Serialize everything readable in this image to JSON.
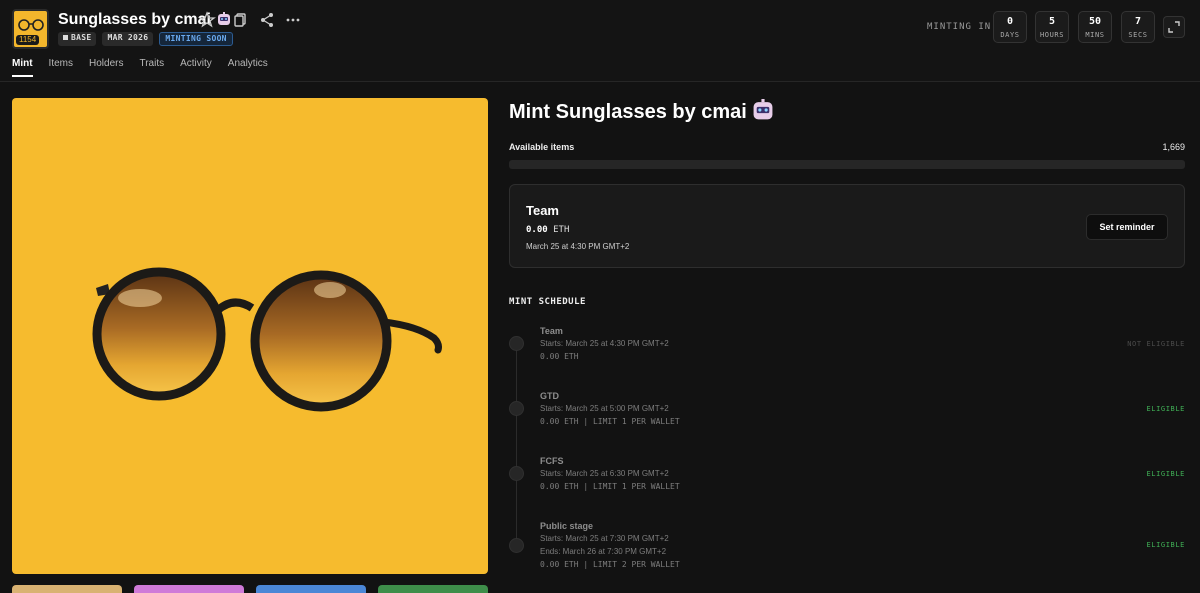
{
  "collection": {
    "title": "Sunglasses by cmai",
    "logo_badge": "1154",
    "tags": [
      "BASE",
      "MAR 2026",
      "MINTING SOON"
    ]
  },
  "header_icons": [
    "star-icon",
    "copy-icon",
    "share-icon",
    "more-icon"
  ],
  "countdown": {
    "label": "MINTING IN",
    "units": [
      {
        "value": "0",
        "label": "DAYS"
      },
      {
        "value": "5",
        "label": "HOURS"
      },
      {
        "value": "50",
        "label": "MINS"
      },
      {
        "value": "7",
        "label": "SECS"
      }
    ]
  },
  "tabs": [
    "Mint",
    "Items",
    "Holders",
    "Traits",
    "Activity",
    "Analytics"
  ],
  "mint": {
    "title": "Mint Sunglasses by cmai",
    "available_label": "Available items",
    "available_value": "1,669",
    "minted_fraction": 0,
    "current_stage": {
      "name": "Team",
      "price": "0.00",
      "currency": "ETH",
      "date": "March 25 at 4:30 PM GMT+2",
      "button": "Set reminder"
    }
  },
  "schedule": {
    "title": "MINT SCHEDULE",
    "stages": [
      {
        "name": "Team",
        "starts": "Starts: March 25 at 4:30 PM GMT+2",
        "ends": "",
        "details": "0.00 ETH",
        "status": "NOT ELIGIBLE"
      },
      {
        "name": "GTD",
        "starts": "Starts: March 25 at 5:00 PM GMT+2",
        "ends": "",
        "details": "0.00 ETH | LIMIT 1 PER WALLET",
        "status": "ELIGIBLE"
      },
      {
        "name": "FCFS",
        "starts": "Starts: March 25 at 6:30 PM GMT+2",
        "ends": "",
        "details": "0.00 ETH | LIMIT 1 PER WALLET",
        "status": "ELIGIBLE"
      },
      {
        "name": "Public stage",
        "starts": "Starts: March 25 at 7:30 PM GMT+2",
        "ends": "Ends: March 26 at 7:30 PM GMT+2",
        "details": "0.00 ETH | LIMIT 2 PER WALLET",
        "status": "ELIGIBLE"
      }
    ]
  },
  "colors": {
    "accent": "#f3b62c",
    "eligible": "#3fae55",
    "hero_background": "#f6bb2e"
  }
}
